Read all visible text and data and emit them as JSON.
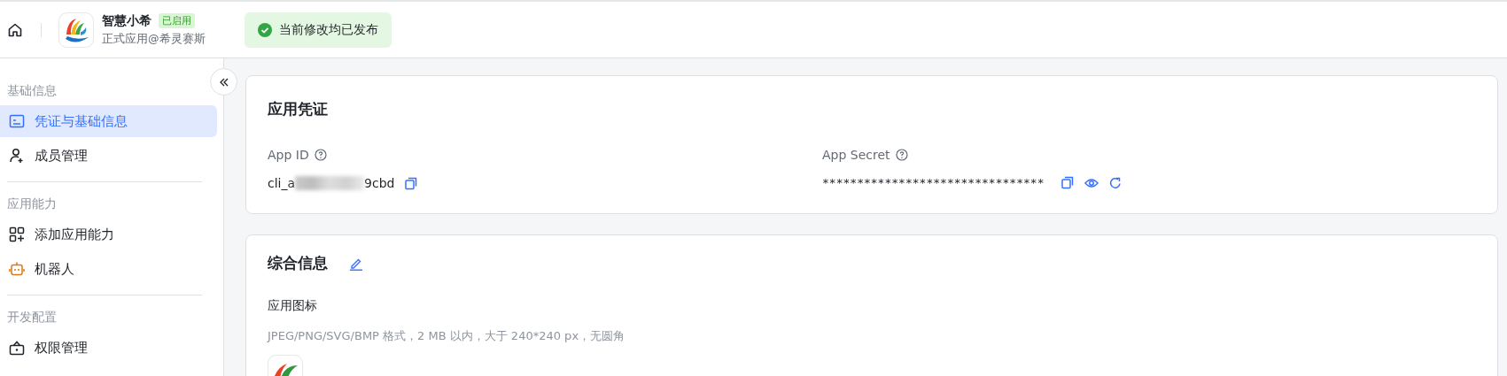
{
  "header": {
    "app_name": "智慧小希",
    "status_badge": "已启用",
    "subtitle": "正式应用@希灵赛斯",
    "toast": "当前修改均已发布"
  },
  "sidebar": {
    "sections": [
      {
        "heading": "基础信息",
        "items": [
          {
            "label": "凭证与基础信息",
            "selected": true
          },
          {
            "label": "成员管理",
            "selected": false
          }
        ]
      },
      {
        "heading": "应用能力",
        "items": [
          {
            "label": "添加应用能力",
            "selected": false
          },
          {
            "label": "机器人",
            "selected": false
          }
        ]
      },
      {
        "heading": "开发配置",
        "items": [
          {
            "label": "权限管理",
            "selected": false
          }
        ]
      }
    ]
  },
  "credentials": {
    "title": "应用凭证",
    "app_id": {
      "label": "App ID",
      "value_start": "cli_a",
      "value_end": "9cbd"
    },
    "app_secret": {
      "label": "App Secret",
      "value": "********************************"
    }
  },
  "general": {
    "title": "综合信息",
    "icon_label": "应用图标",
    "icon_hint": "JPEG/PNG/SVG/BMP 格式，2 MB 以内，大于 240*240 px，无圆角"
  }
}
